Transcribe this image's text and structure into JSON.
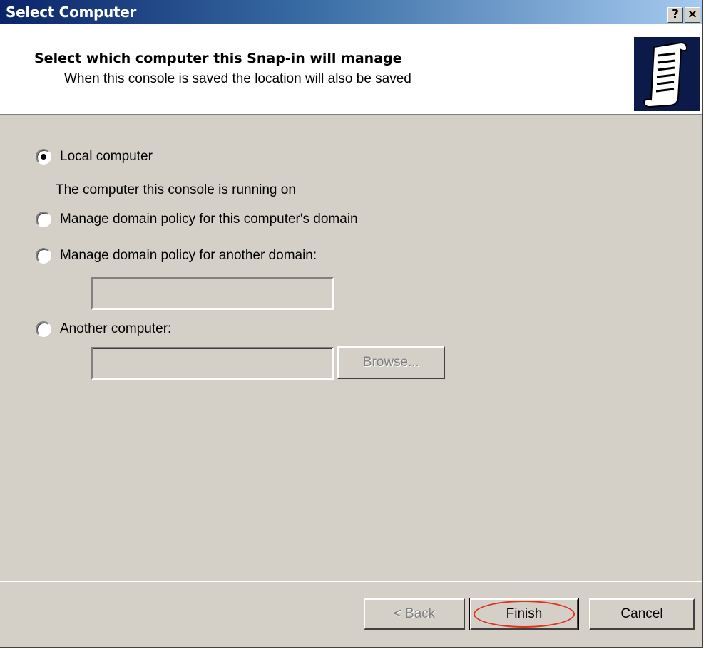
{
  "window": {
    "title": "Select Computer",
    "help_label": "?",
    "close_label": "×"
  },
  "header": {
    "title": "Select which computer this Snap-in will manage",
    "subtitle": "When this console is saved the location will also be saved",
    "icon": "scroll-document-icon"
  },
  "options": {
    "local": {
      "label": "Local computer",
      "checked": true
    },
    "local_desc": "The computer this console is running on",
    "this_domain": {
      "label": "Manage domain policy for this computer's domain",
      "checked": false
    },
    "another_domain": {
      "label": "Manage domain policy for another domain:",
      "checked": false,
      "value": ""
    },
    "another_computer": {
      "label": "Another computer:",
      "checked": false,
      "value": ""
    }
  },
  "buttons": {
    "browse": "Browse...",
    "back": "< Back",
    "finish": "Finish",
    "cancel": "Cancel"
  },
  "colors": {
    "titlebar_start": "#0a246a",
    "titlebar_end": "#a6caf0",
    "dialog_face": "#d4d0c8",
    "highlight_annotation": "#e0301e"
  }
}
